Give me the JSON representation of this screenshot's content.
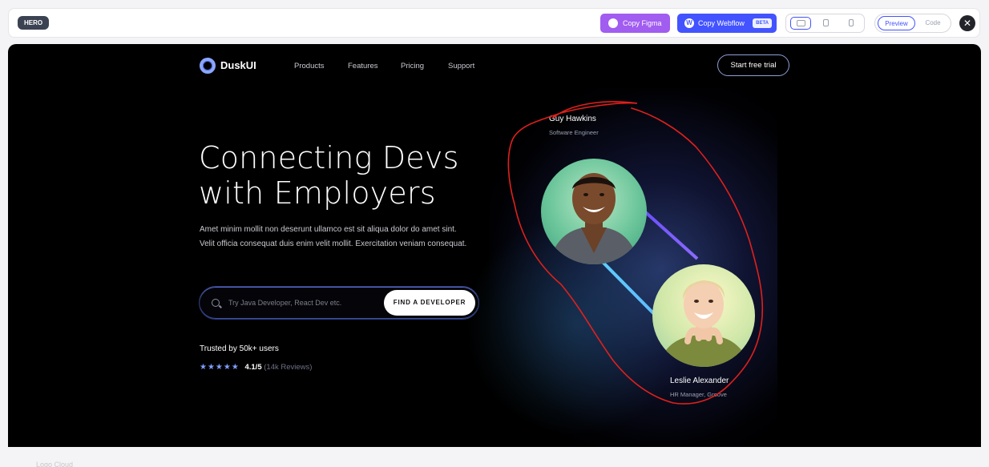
{
  "toolbar": {
    "section_tag": "HERO",
    "copy_figma": "Copy Figma",
    "copy_webflow": "Copy Webflow",
    "webflow_badge": "BETA",
    "webflow_glyph": "W",
    "preview": "Preview",
    "code": "Code",
    "close": "✕"
  },
  "hero": {
    "brand": "DuskUI",
    "nav": [
      "Products",
      "Features",
      "Pricing",
      "Support"
    ],
    "cta": "Start free trial",
    "headline_line1": "Connecting Devs",
    "headline_line2": "with Employers",
    "lead": "Amet minim mollit non deserunt ullamco est sit aliqua dolor do amet sint. Velit officia consequat duis enim velit mollit. Exercitation veniam consequat.",
    "search_placeholder": "Try Java Developer, React Dev etc.",
    "find_button": "FIND A DEVELOPER",
    "trusted": "Trusted by 50k+ users",
    "stars": "★★★★★",
    "score": "4.1/5",
    "reviews": "(14k Reviews)",
    "person1": {
      "name": "Guy Hawkins",
      "role": "Software Engineer"
    },
    "person2": {
      "name": "Leslie Alexander",
      "role": "HR Manager, Groove"
    }
  },
  "colors": {
    "accent": "#4353ff",
    "figma": "#a15cf0",
    "annotation": "#e0201c"
  }
}
